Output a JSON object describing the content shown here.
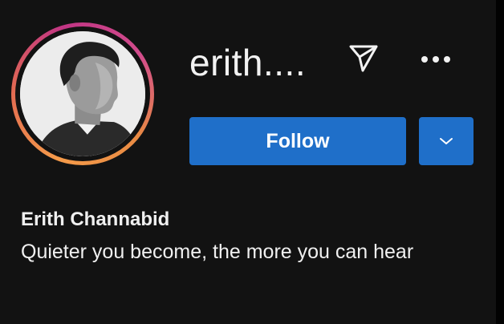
{
  "profile": {
    "username": "erith....",
    "full_name": "Erith Channabid",
    "bio": "Quieter you become, the more you can hear"
  },
  "actions": {
    "follow_label": "Follow",
    "send_icon": "paper-plane-icon",
    "more_icon": "more-horizontal-icon",
    "suggest_icon": "chevron-down-icon"
  },
  "colors": {
    "background": "#121212",
    "button": "#1f6fc9",
    "text": "#f0f0f0",
    "story_ring": [
      "#f59b4a",
      "#e26a52",
      "#c13584"
    ]
  }
}
